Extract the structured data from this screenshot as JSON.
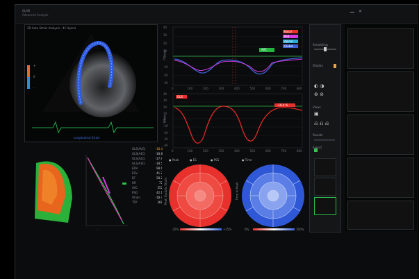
{
  "app": {
    "title_line1": "QLAB",
    "title_line2": "Advanced Analysis",
    "window_controls": [
      "minimize-icon",
      "close-icon"
    ]
  },
  "echo_view": {
    "header": "2D Auto Strain Analysis - 4C Apical",
    "footer": "Longitudinal Strain",
    "scale_ticks": [
      "+",
      "0",
      "-"
    ]
  },
  "metrics_panel": {
    "rows": [
      {
        "label": "GLS(AVG)",
        "value": "-18.4"
      },
      {
        "label": "GLS(A4C)",
        "value": "-18.8"
      },
      {
        "label": "GLS(A2C)",
        "value": "-17.9"
      },
      {
        "label": "GLS(A3C)",
        "value": "-18.5"
      },
      {
        "label": "EDV",
        "value": "98.6"
      },
      {
        "label": "ESV",
        "value": "41.2"
      },
      {
        "label": "EF",
        "value": "58.2"
      },
      {
        "label": "HR",
        "value": "72"
      },
      {
        "label": "AVC",
        "value": "352"
      },
      {
        "label": "PSD",
        "value": "42.1"
      },
      {
        "label": "Strain",
        "value": "-18.4"
      },
      {
        "label": "TTP",
        "value": "368"
      }
    ]
  },
  "curve_chart_top": {
    "ylabel": "Strain",
    "legend": [
      "Basal",
      "Mid",
      "Apical",
      "Global"
    ],
    "badge": "AVC",
    "yticks": [
      "40",
      "30",
      "20",
      "10",
      "0",
      "-10",
      "-20",
      "-30"
    ],
    "xticks": [
      "0",
      "100",
      "200",
      "300",
      "400",
      "500",
      "600",
      "700",
      "800"
    ]
  },
  "curve_chart_bottom": {
    "ylabel": "Strain",
    "tag_left": "GLS",
    "tag_right": "-18.4 %",
    "yticks": [
      "40",
      "30",
      "20",
      "10",
      "0",
      "-10",
      "-20",
      "-30",
      "-40"
    ],
    "xticks": [
      "0",
      "100",
      "200",
      "300",
      "400",
      "500",
      "600",
      "700",
      "800"
    ]
  },
  "bullseye_left": {
    "legend": [
      "Peak",
      "ES",
      "PSS"
    ],
    "axis_label": "Peak Systolic Strain",
    "scale_min": "-25%",
    "scale_max": "+25%"
  },
  "bullseye_right": {
    "legend": [
      "Time"
    ],
    "axis_label": "Time to Peak",
    "scale_min": "0%",
    "scale_max": "100%"
  },
  "side_panel": {
    "labels": [
      "Smoothing",
      "Display",
      "Views",
      "Results",
      "Export"
    ]
  },
  "colors": {
    "strain_red": "#e8302c",
    "strain_blue": "#3a62d8",
    "curve_magenta": "#d63ce2",
    "curve_green": "#39c452",
    "accent_orange": "#f2a23a"
  }
}
